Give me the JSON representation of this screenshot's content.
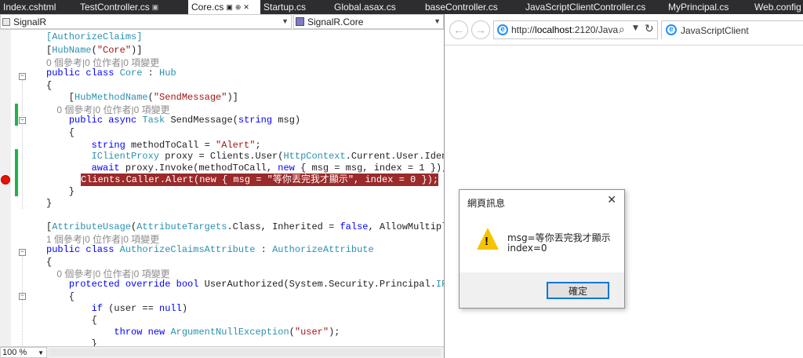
{
  "tabs": [
    {
      "label": "Index.cshtml",
      "active": false
    },
    {
      "label": "TestController.cs",
      "active": false,
      "icon": "pin-icon"
    },
    {
      "label": "Core.cs",
      "active": true,
      "icon": "pin-close-icons"
    },
    {
      "label": "Startup.cs",
      "active": false
    },
    {
      "label": "Global.asax.cs",
      "active": false
    },
    {
      "label": "baseController.cs",
      "active": false
    },
    {
      "label": "JavaScriptClientController.cs",
      "active": false
    },
    {
      "label": "MyPrincipal.cs",
      "active": false
    },
    {
      "label": "Web.config",
      "active": false
    }
  ],
  "navbar": {
    "project": "SignalR",
    "class": "SignalR.Core"
  },
  "code": [
    "[AuthorizeClaims]",
    "[HubName(\"Core\")]",
    "0 個參考|0 位作者|0 項變更",
    "public class Core : Hub",
    "{",
    "    [HubMethodName(\"SendMessage\")]",
    "    0 個參考|0 位作者|0 項變更",
    "    public async Task SendMessage(string msg)",
    "    {",
    "        string methodToCall = \"Alert\";",
    "        IClientProxy proxy = Clients.User(HttpContext.Current.User.Identity.Name);",
    "        await proxy.Invoke(methodToCall, new { msg = msg, index = 1 });",
    "        Clients.Caller.Alert(new { msg = \"等你丟完我才顯示\", index = 0 });",
    "    }",
    "}",
    "",
    "[AttributeUsage(AttributeTargets.Class, Inherited = false, AllowMultiple = false)]",
    "1 個參考|0 位作者|0 項變更",
    "public class AuthorizeClaimsAttribute : AuthorizeAttribute",
    "{",
    "    0 個參考|0 位作者|0 項變更",
    "    protected override bool UserAuthorized(System.Security.Principal.IPrincipal user)",
    "    {",
    "        if (user == null)",
    "        {",
    "            throw new ArgumentNullException(\"user\");",
    "        }"
  ],
  "status": {
    "zoom": "100 %"
  },
  "browser": {
    "url_prefix": "http://",
    "url_host": "localhost",
    "url_rest": ":2120/Java",
    "tab_title": "JavaScriptClient"
  },
  "dialog": {
    "title": "網頁訊息",
    "message_line1": "msg=等你丟完我才顯示",
    "message_line2": "index=0",
    "ok_label": "確定"
  },
  "colors": {
    "breakpoint": "#e51400",
    "change_bar": "#1fb34a",
    "highlight": "#9b2a2a",
    "keyword": "#0000ff",
    "type": "#2b91af",
    "string": "#a31515"
  }
}
